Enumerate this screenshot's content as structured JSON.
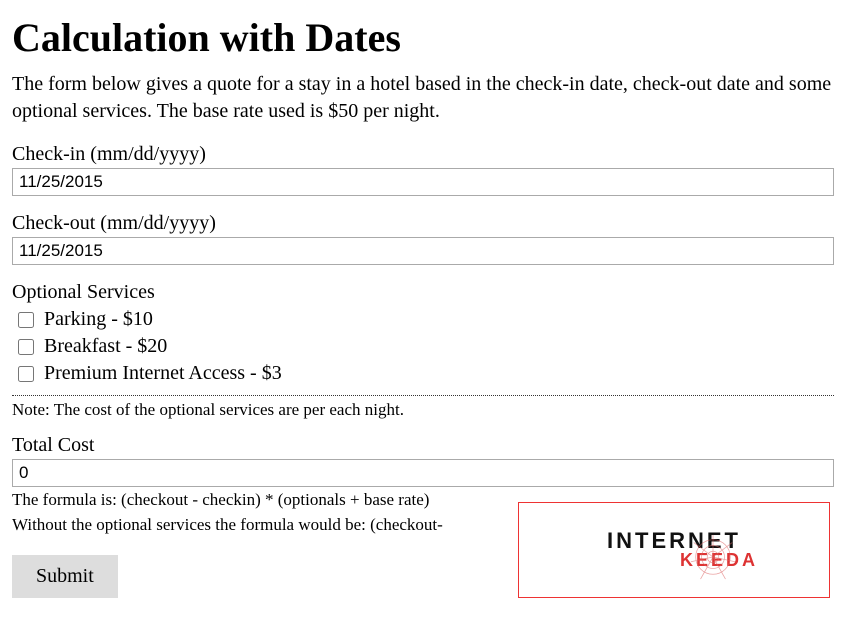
{
  "page_title": "Calculation with Dates",
  "intro": "The form below gives a quote for a stay in a hotel based in the check-in date, check-out date and some optional services. The base rate used is $50 per night.",
  "checkin": {
    "label": "Check-in (mm/dd/yyyy)",
    "value": "11/25/2015"
  },
  "checkout": {
    "label": "Check-out (mm/dd/yyyy)",
    "value": "11/25/2015"
  },
  "optional": {
    "heading": "Optional Services",
    "items": [
      {
        "label": "Parking - $10"
      },
      {
        "label": "Breakfast - $20"
      },
      {
        "label": "Premium Internet Access - $3"
      }
    ]
  },
  "note": "Note: The cost of the optional services are per each night.",
  "total": {
    "label": "Total Cost",
    "value": "0"
  },
  "formula_line1": "The formula is: (checkout - checkin) * (optionals + base rate)",
  "formula_line2": "Without the optional services the formula would be: (checkout-",
  "submit_label": "Submit",
  "watermark": {
    "line1": "INTERNET",
    "line2": "KEEDA"
  }
}
